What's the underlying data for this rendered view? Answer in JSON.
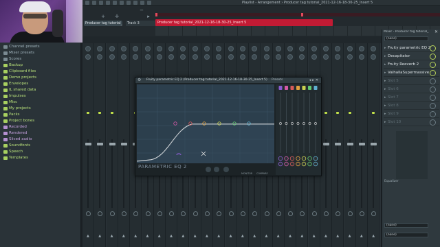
{
  "topbar": {
    "title": "Playlist - Arrangement › Producer tag tutorial_2021-12-16-18-30-25_Insert 5"
  },
  "arrangement": {
    "pattern_tab": "Producer tag tutorial_20",
    "track_tab": "Track 3",
    "clip_label": "Producer tag tutorial_2021-12-16-18-30-25_Insert 5",
    "tools": [
      "draw-icon",
      "paint-icon",
      "delete-icon",
      "mute-icon",
      "slice-icon",
      "select-icon",
      "zoom-icon",
      "play-icon"
    ]
  },
  "browser": {
    "items": [
      {
        "label": "Channel presets",
        "icon": "folder-icon",
        "color": "#7a8a92"
      },
      {
        "label": "Mixer presets",
        "icon": "folder-icon",
        "color": "#7a8a92"
      },
      {
        "label": "Scores",
        "icon": "folder-icon",
        "color": "#7a8a92"
      },
      {
        "label": "Backup",
        "icon": "folder-icon",
        "color": "#a8d060",
        "tone": "hi"
      },
      {
        "label": "Clipboard files",
        "icon": "folder-icon",
        "color": "#a8d060",
        "tone": "hi"
      },
      {
        "label": "Demo projects",
        "icon": "folder-icon",
        "color": "#a8d060",
        "tone": "hi"
      },
      {
        "label": "Envelopes",
        "icon": "folder-icon",
        "color": "#a8d060",
        "tone": "hi"
      },
      {
        "label": "IL shared data",
        "icon": "folder-icon",
        "color": "#a8d060",
        "tone": "hi"
      },
      {
        "label": "Impulses",
        "icon": "folder-icon",
        "color": "#a8d060",
        "tone": "hi"
      },
      {
        "label": "Misc",
        "icon": "folder-icon",
        "color": "#a8d060",
        "tone": "hi"
      },
      {
        "label": "My projects",
        "icon": "folder-icon",
        "color": "#a8d060",
        "tone": "hi"
      },
      {
        "label": "Packs",
        "icon": "folder-icon",
        "color": "#a8d060",
        "tone": "hi"
      },
      {
        "label": "Project bones",
        "icon": "folder-icon",
        "color": "#a8d060",
        "tone": "hi"
      },
      {
        "label": "Recorded",
        "icon": "folder-icon",
        "color": "#b48fd0",
        "tone": "ppl"
      },
      {
        "label": "Rendered",
        "icon": "folder-icon",
        "color": "#b48fd0",
        "tone": "ppl"
      },
      {
        "label": "Sliced audio",
        "icon": "folder-icon",
        "color": "#b48fd0",
        "tone": "ppl"
      },
      {
        "label": "Soundfonts",
        "icon": "folder-icon",
        "color": "#a8d060",
        "tone": "hi"
      },
      {
        "label": "Speech",
        "icon": "folder-icon",
        "color": "#a8d060",
        "tone": "hi"
      },
      {
        "label": "Templates",
        "icon": "folder-icon",
        "color": "#a8d060",
        "tone": "hi"
      }
    ]
  },
  "eq": {
    "title": "Fruity parametric EQ 2 (Producer tag tutorial_2021-12-16-18-30-25_Insert 5)",
    "presets": "Presets",
    "brand": "PARAMETRIC EQ 2",
    "monitor": "MONITOR",
    "compare": "COMPARE",
    "band_colors": [
      "#8a5cd0",
      "#d65aa8",
      "#d65a5a",
      "#e0a040",
      "#c8d050",
      "#60c870",
      "#60b0d0"
    ]
  },
  "insert": {
    "title": "Mixer - Producer tag tutorial_",
    "input_select": "(none)",
    "output_select": "(none)",
    "slots": [
      {
        "name": "Fruity parametric EQ 2",
        "active": true
      },
      {
        "name": "Decapitator",
        "active": true
      },
      {
        "name": "Fruity Reeverb 2",
        "active": true
      },
      {
        "name": "ValhallaSupermassive",
        "active": true
      },
      {
        "name": "Slot 5",
        "active": false
      },
      {
        "name": "Slot 6",
        "active": false
      },
      {
        "name": "Slot 7",
        "active": false
      },
      {
        "name": "Slot 8",
        "active": false
      },
      {
        "name": "Slot 9",
        "active": false
      },
      {
        "name": "Slot 10",
        "active": false
      }
    ],
    "eq_caption": "Equalizer"
  },
  "colors": {
    "clip": "#c21b34",
    "accent_green": "#c3e24a",
    "eq_graph_bg": "#2c3f4d"
  }
}
